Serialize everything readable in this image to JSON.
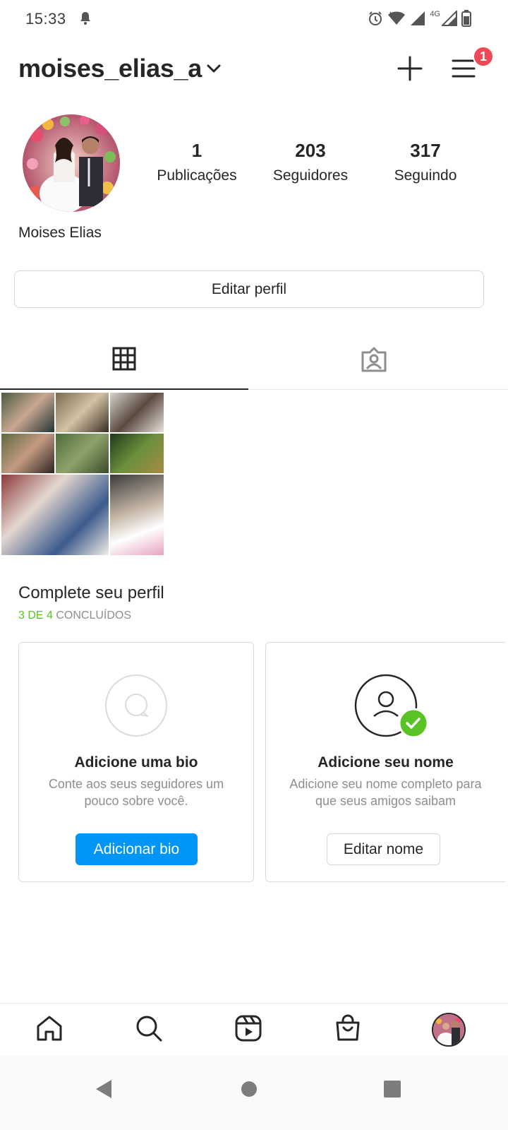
{
  "status_bar": {
    "time": "15:33",
    "network": "4G",
    "icons": [
      "bell-icon",
      "alarm-icon",
      "wifi-icon",
      "signal-icon",
      "battery-icon"
    ]
  },
  "header": {
    "username": "moises_elias_a",
    "notification_count": "1",
    "icons": [
      "chevron-down-icon",
      "plus-icon",
      "menu-icon"
    ]
  },
  "profile": {
    "display_name": "Moises Elias",
    "stats": [
      {
        "value": "1",
        "label": "Publicações"
      },
      {
        "value": "203",
        "label": "Seguidores"
      },
      {
        "value": "317",
        "label": "Seguindo"
      }
    ],
    "edit_button": "Editar perfil"
  },
  "tabs": {
    "items": [
      "grid-icon",
      "tagged-icon"
    ],
    "active": "grid-icon"
  },
  "complete_profile": {
    "title": "Complete seu perfil",
    "progress_done": "3 DE 4",
    "progress_label": " CONCLUÍDOS",
    "cards": [
      {
        "heading": "Adicione uma bio",
        "text": "Conte aos seus seguidores um pouco sobre você.",
        "button": "Adicionar bio",
        "icon": "speech-bubble-icon",
        "completed": false
      },
      {
        "heading": "Adicione seu nome",
        "text": "Adicione seu nome completo para que seus amigos saibam",
        "button": "Editar nome",
        "icon": "person-icon",
        "completed": true
      }
    ]
  },
  "bottom_nav": {
    "items": [
      "home-icon",
      "search-icon",
      "reels-icon",
      "shop-icon",
      "profile-avatar"
    ]
  },
  "system_nav": {
    "items": [
      "back-icon",
      "home-circle-icon",
      "recents-icon"
    ]
  },
  "colors": {
    "accent_blue": "#0095f6",
    "badge_red": "#ed4956",
    "success_green": "#58c322",
    "text_primary": "#262626",
    "text_secondary": "#8e8e8e"
  }
}
